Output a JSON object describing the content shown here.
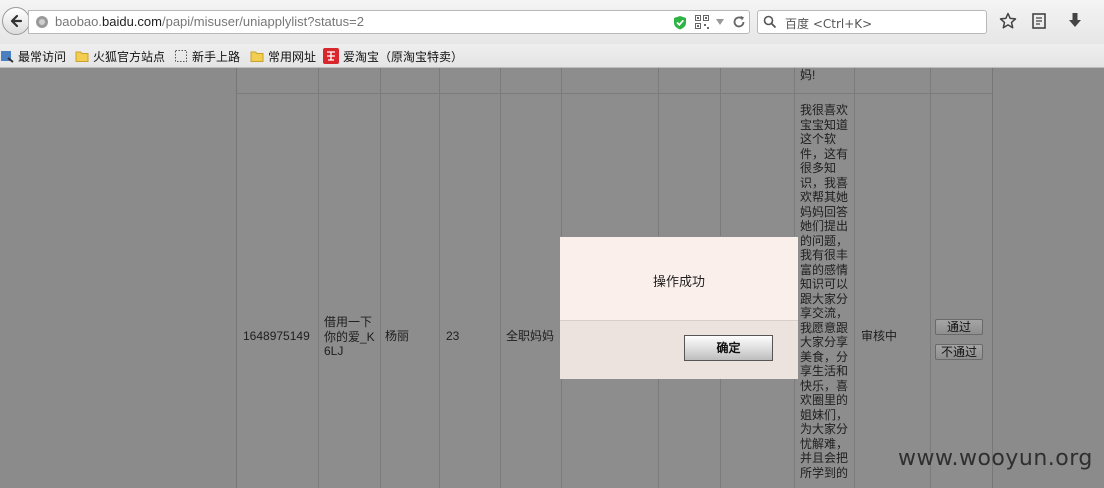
{
  "browser": {
    "url_prefix": "baobao.",
    "url_domain": "baidu.com",
    "url_path": "/papi/misuser/uniapplylist?status=2",
    "search_placeholder": "百度 <Ctrl+K>"
  },
  "bookmarks": [
    {
      "label": "最常访问",
      "icon": "most-visited-icon"
    },
    {
      "label": "火狐官方站点",
      "icon": "folder-icon"
    },
    {
      "label": "新手上路",
      "icon": "dotted-page-icon"
    },
    {
      "label": "常用网址",
      "icon": "folder-icon"
    },
    {
      "label": "爱淘宝（原淘宝特卖）",
      "icon": "taobao-icon"
    }
  ],
  "table": {
    "top_fragment": "妈!",
    "row": {
      "id": "1648975149",
      "nickname": "借用一下你的爱_K6LJ",
      "name": "杨丽",
      "age": "23",
      "identity": "全职妈妈",
      "intro": "我很喜欢宝宝知道这个软件，这有很多知识，我喜欢帮其她妈妈回答她们提出的问题，我有很丰富的感情知识可以跟大家分享交流，我愿意跟大家分享美食，分享生活和快乐，喜欢圈里的姐妹们，为大家分忧解难，并且会把所学到的",
      "status": "审核中",
      "approve_label": "通过",
      "reject_label": "不通过"
    }
  },
  "modal": {
    "message": "操作成功",
    "ok_label": "确定"
  },
  "watermark": "www.wooyun.org",
  "colors": {
    "overlay": "#8b8b8b",
    "modal_bg": "#faefea",
    "shield_green": "#2fb344"
  }
}
